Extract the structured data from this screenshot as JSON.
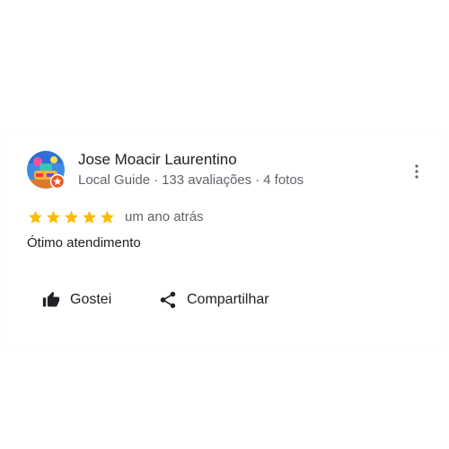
{
  "review": {
    "author_name": "Jose Moacir Laurentino",
    "author_badge": "Local Guide",
    "separator": "·",
    "reviews_count": "133 avaliações",
    "photos_count": "4 fotos",
    "rating": 5,
    "max_rating": 5,
    "time_ago": "um ano atrás",
    "text": "Ótimo atendimento"
  },
  "actions": {
    "like_label": "Gostei",
    "share_label": "Compartilhar"
  },
  "icons": {
    "more": "more-vert-icon",
    "like": "thumb-up-icon",
    "share": "share-icon",
    "star": "star-icon"
  },
  "colors": {
    "star": "#fbbc04",
    "text_primary": "#202124",
    "text_secondary": "#5f6368",
    "icon": "#3c4043"
  }
}
